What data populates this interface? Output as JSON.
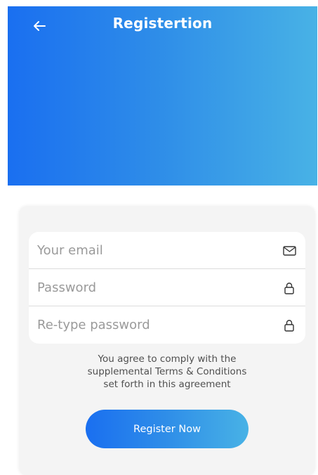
{
  "header": {
    "title": "Registertion",
    "back_icon": "arrow-left-icon",
    "gradient_colors": [
      "#1a6ff0",
      "#48b2e6"
    ]
  },
  "form": {
    "fields": [
      {
        "placeholder": "Your email",
        "value": "",
        "icon": "mail-icon"
      },
      {
        "placeholder": "Password",
        "value": "",
        "icon": "lock-icon"
      },
      {
        "placeholder": "Re-type password",
        "value": "",
        "icon": "lock-icon"
      }
    ],
    "terms_lines": [
      "You agree to comply with the",
      "supplemental Terms & Conditions",
      "set forth in this agreement"
    ],
    "submit_label": "Register Now"
  }
}
